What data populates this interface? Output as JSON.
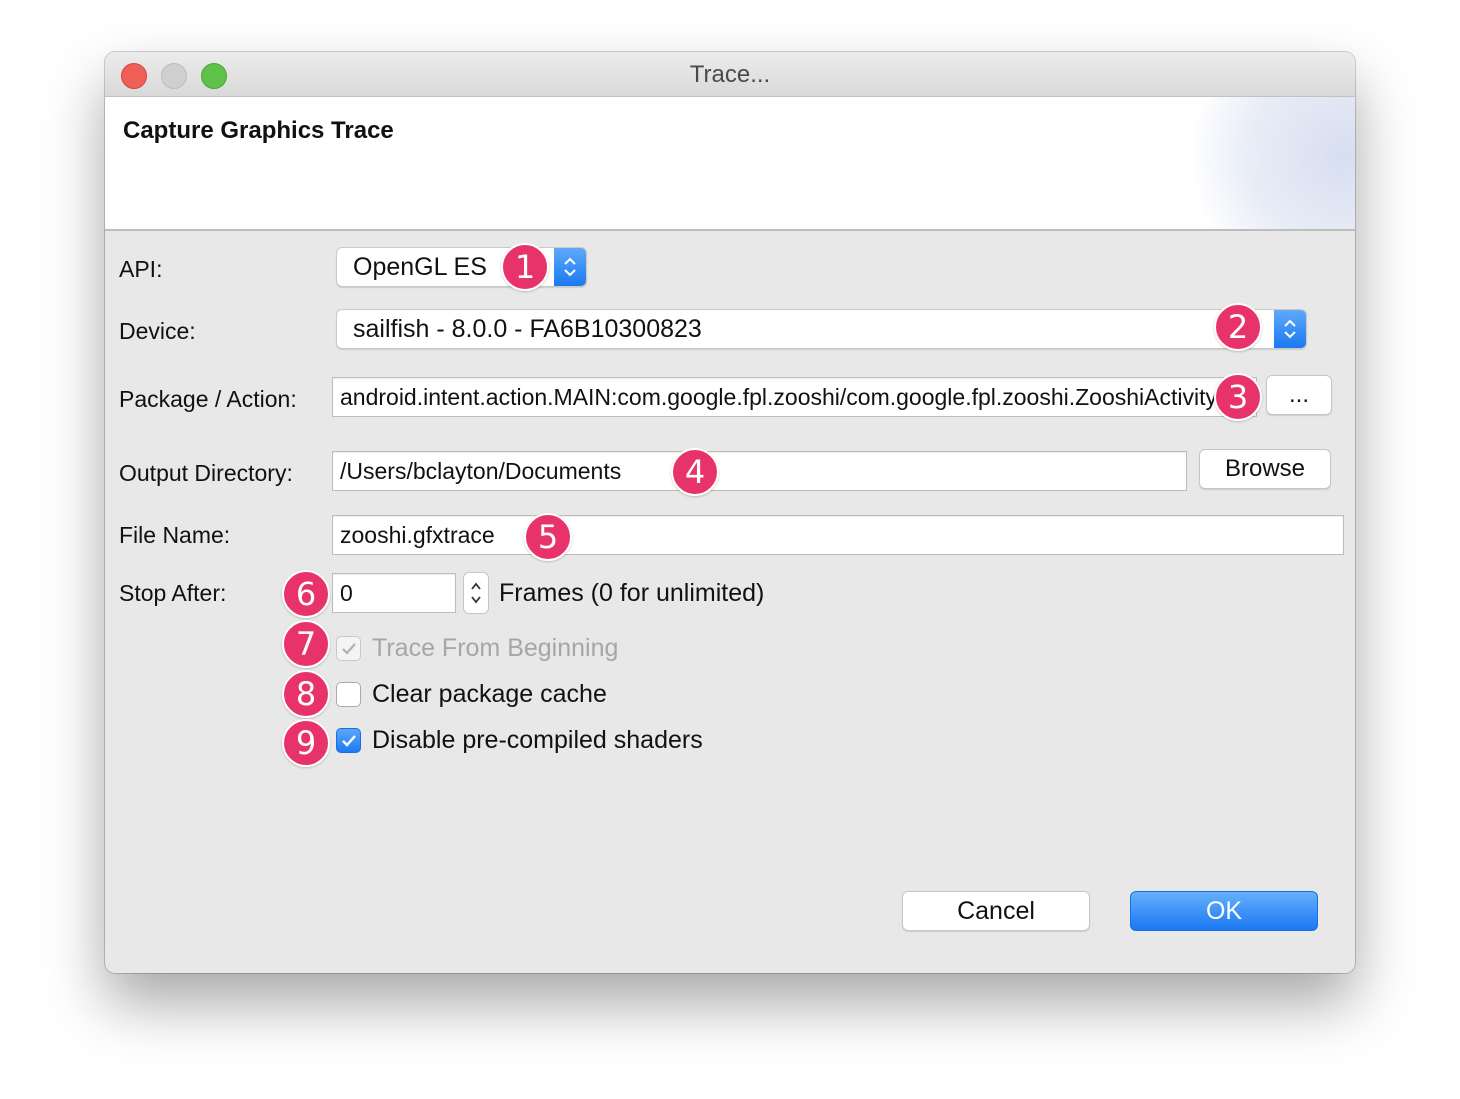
{
  "window": {
    "title": "Trace..."
  },
  "header": {
    "title": "Capture Graphics Trace"
  },
  "form": {
    "api": {
      "label": "API:",
      "value": "OpenGL ES"
    },
    "device": {
      "label": "Device:",
      "value": "sailfish - 8.0.0 - FA6B10300823"
    },
    "package": {
      "label": "Package / Action:",
      "value": "android.intent.action.MAIN:com.google.fpl.zooshi/com.google.fpl.zooshi.ZooshiActivity",
      "button_label": "..."
    },
    "output": {
      "label": "Output Directory:",
      "value": "/Users/bclayton/Documents",
      "button_label": "Browse"
    },
    "file": {
      "label": "File Name:",
      "value": "zooshi.gfxtrace"
    },
    "stop_after": {
      "label": "Stop After:",
      "value": "0",
      "suffix": "Frames (0 for unlimited)"
    },
    "checkboxes": [
      {
        "label": "Trace From Beginning",
        "checked": true,
        "enabled": false
      },
      {
        "label": "Clear package cache",
        "checked": false,
        "enabled": true
      },
      {
        "label": "Disable pre-compiled shaders",
        "checked": true,
        "enabled": true
      }
    ]
  },
  "buttons": {
    "cancel": "Cancel",
    "ok": "OK"
  },
  "badges": [
    "1",
    "2",
    "3",
    "4",
    "5",
    "6",
    "7",
    "8",
    "9"
  ],
  "colors": {
    "badge": "#e8336a",
    "accent": "#1b79f0"
  }
}
